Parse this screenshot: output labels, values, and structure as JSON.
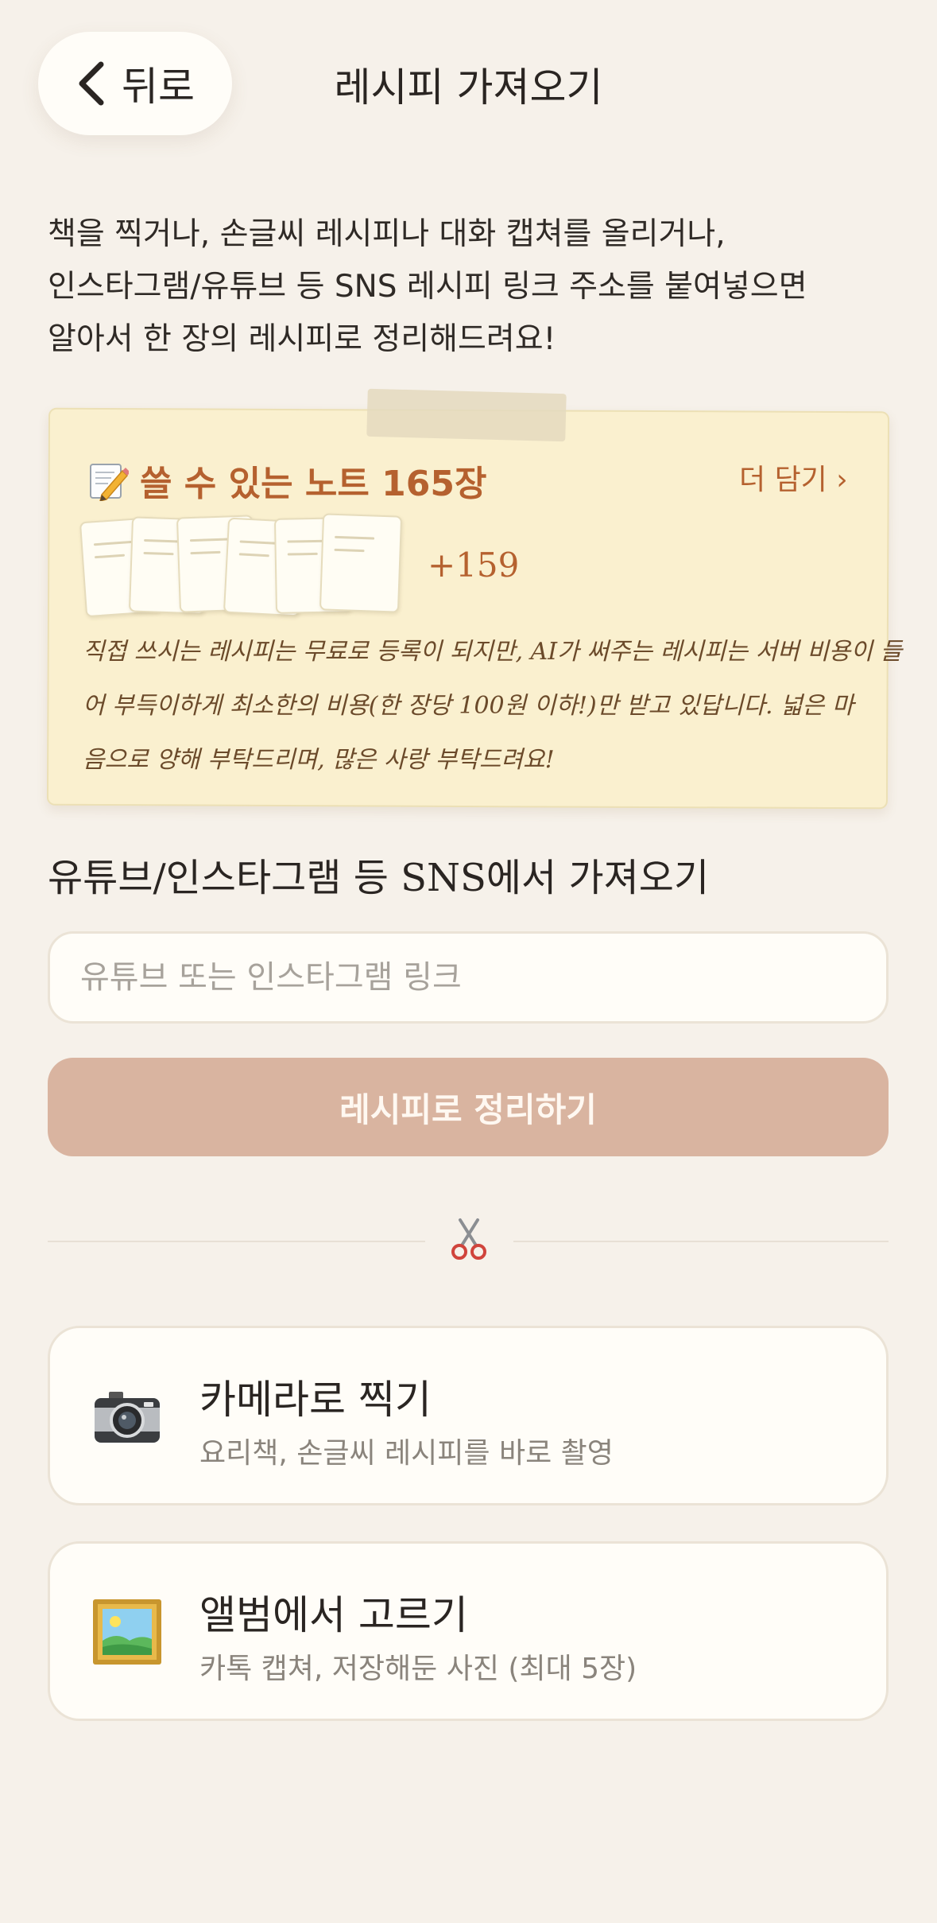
{
  "header": {
    "back_label": "뒤로",
    "title": "레시피 가져오기"
  },
  "intro": {
    "lines": [
      "책을 찍거나, 손글씨 레시피나 대화 캡쳐를 올리거나,",
      "인스타그램/유튜브 등 SNS 레시피 링크 주소를 붙여넣으면",
      "알아서 한 장의 레시피로 정리해드려요!"
    ]
  },
  "note_card": {
    "heading_icon": "memo-pencil-icon",
    "heading": "쓸 수 있는 노트 165장",
    "more_link": "더 담기 ›",
    "visible_sheets": 6,
    "extra_count": "+159",
    "message_lines": [
      "직접 쓰시는 레시피는 무료로 등록이 되지만, AI가 써주는 레시피는 서버 비용이 들",
      "어 부득이하게 최소한의 비용(한 장당 100원 이하!)만 받고 있답니다. 넓은 마",
      "음으로 양해 부탁드리며, 많은 사랑 부탁드려요!"
    ],
    "colors": {
      "background": "#faf0cf",
      "accent": "#b5612f"
    }
  },
  "sns": {
    "section_title": "유튜브/인스타그램 등 SNS에서 가져오기",
    "input_value": "",
    "input_placeholder": "유튜브 또는 인스타그램 링크",
    "button_label": "레시피로 정리하기",
    "button_color": "#d9b4a0"
  },
  "divider": {
    "icon": "scissors-icon"
  },
  "options": [
    {
      "icon": "camera-icon",
      "title": "카메라로 찍기",
      "subtitle": "요리책, 손글씨 레시피를 바로 촬영"
    },
    {
      "icon": "framed-picture-icon",
      "title": "앨범에서 고르기",
      "subtitle": "카톡 캡쳐, 저장해둔 사진 (최대 5장)"
    }
  ]
}
